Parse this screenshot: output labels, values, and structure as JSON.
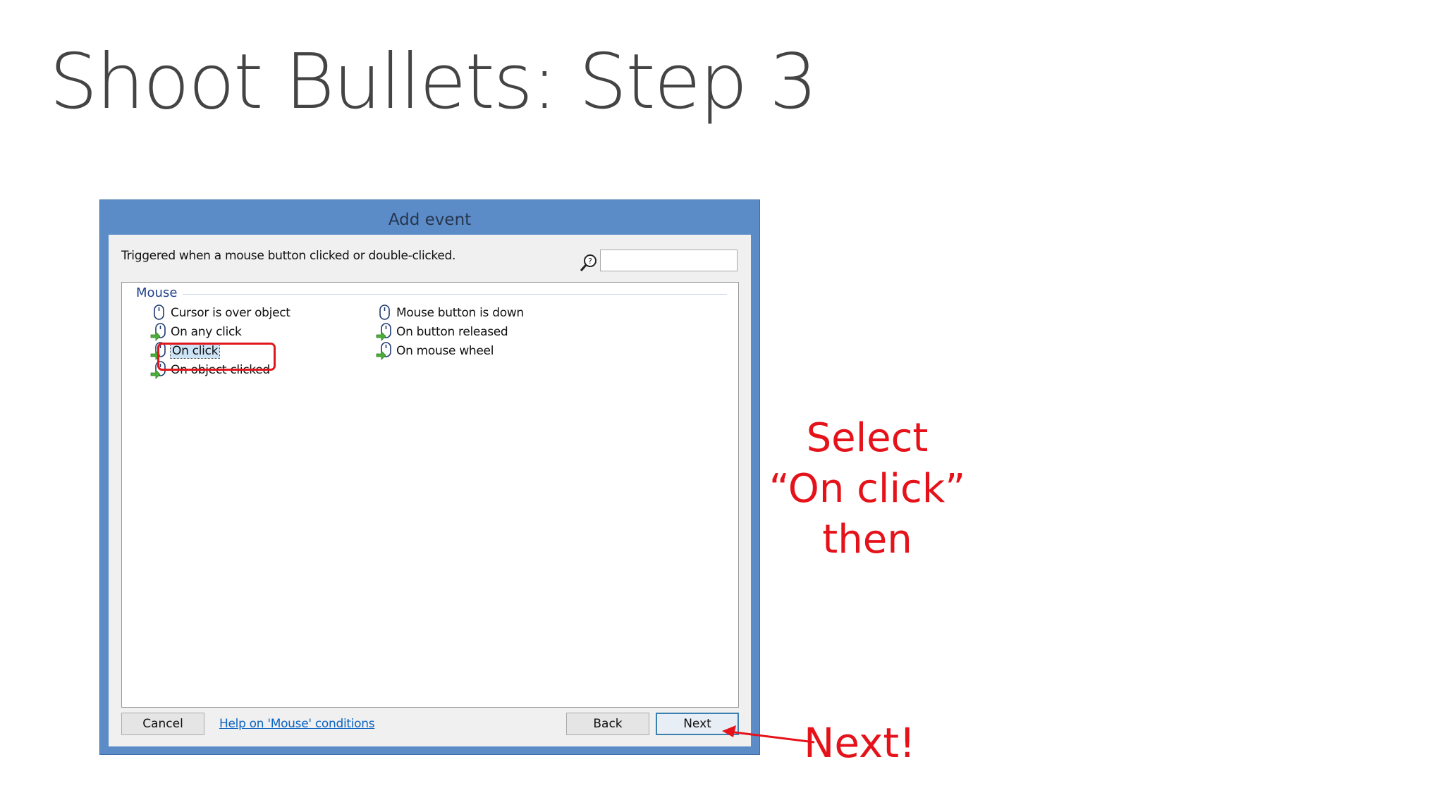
{
  "slide": {
    "title": "Shoot Bullets: Step 3"
  },
  "dialog": {
    "title": "Add event",
    "description": "Triggered when a mouse button clicked or double-clicked.",
    "search": {
      "value": "",
      "placeholder": ""
    },
    "group": {
      "header": "Mouse",
      "items": [
        {
          "label": "Cursor is over object",
          "icon": "mouse-icon"
        },
        {
          "label": "On any click",
          "icon": "mouse-arrow-icon"
        },
        {
          "label": "On click",
          "icon": "mouse-arrow-icon",
          "selected": true
        },
        {
          "label": "On object clicked",
          "icon": "mouse-arrow-icon"
        },
        {
          "label": "Mouse button is down",
          "icon": "mouse-icon"
        },
        {
          "label": "On button released",
          "icon": "mouse-arrow-icon"
        },
        {
          "label": "On mouse wheel",
          "icon": "mouse-arrow-icon"
        }
      ]
    },
    "buttons": {
      "cancel": "Cancel",
      "help": "Help on 'Mouse' conditions",
      "back": "Back",
      "next": "Next"
    }
  },
  "annotations": {
    "select_line1": "Select",
    "select_line2": "“On click”",
    "select_line3": "then",
    "next": "Next!",
    "color": "#e5121a"
  },
  "colors": {
    "dialog_frame": "#5b8cc8",
    "title_text": "#444444",
    "link": "#0b64c2"
  }
}
